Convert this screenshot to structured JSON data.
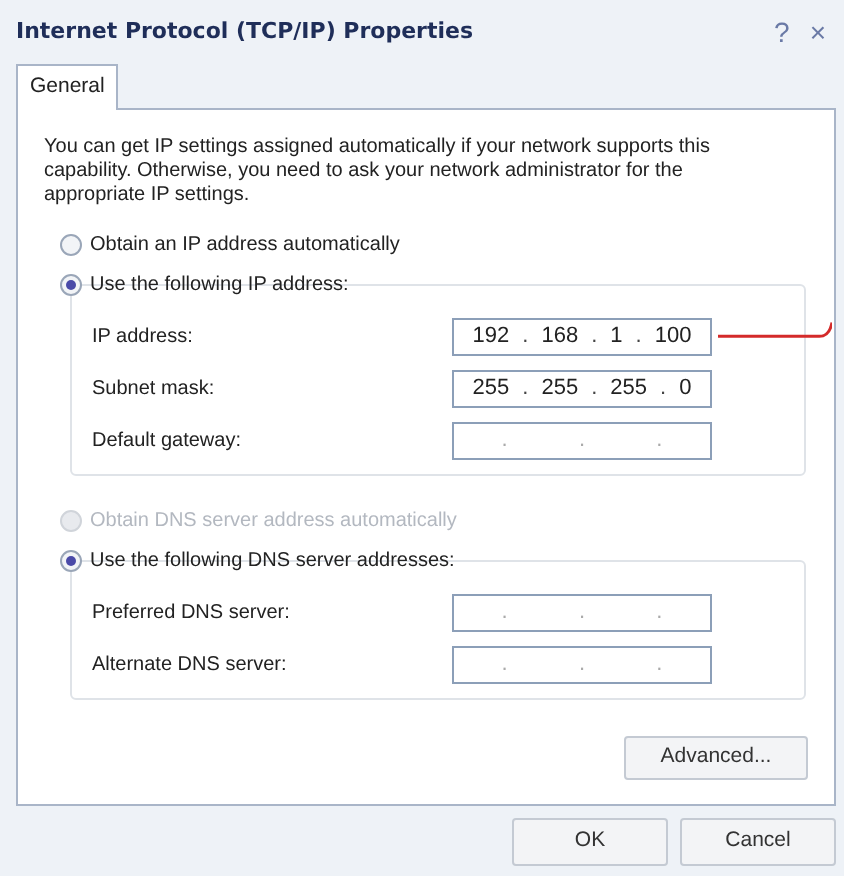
{
  "window": {
    "title": "Internet Protocol (TCP/IP) Properties",
    "help": "?",
    "close": "×"
  },
  "tabs": [
    {
      "label": "General",
      "selected": true
    }
  ],
  "intro": "You can get IP settings assigned automatically if your network supports this capability. Otherwise, you need to ask your network administrator for the appropriate IP settings.",
  "ip_group": {
    "options": [
      {
        "label": "Obtain an IP address automatically",
        "selected": false,
        "disabled": false
      },
      {
        "label": "Use the following IP address:",
        "selected": true,
        "disabled": false
      }
    ],
    "fields": [
      {
        "label": "IP address:",
        "parts": [
          "192",
          ".",
          "168",
          ".",
          "1",
          ".",
          "100"
        ],
        "annotated": true
      },
      {
        "label": "Subnet mask:",
        "parts": [
          "255",
          ".",
          "255",
          ".",
          "255",
          ".",
          "0"
        ],
        "annotated": false
      },
      {
        "label": "Default gateway:",
        "parts": [
          ".",
          ".",
          "."
        ],
        "annotated": false
      }
    ]
  },
  "dns_group": {
    "options": [
      {
        "label": "Obtain DNS server address automatically",
        "selected": false,
        "disabled": true
      },
      {
        "label": "Use the following DNS server addresses:",
        "selected": true,
        "disabled": false
      }
    ],
    "fields": [
      {
        "label": "Preferred DNS server:",
        "parts": [
          ".",
          ".",
          "."
        ],
        "annotated": false
      },
      {
        "label": "Alternate DNS server:",
        "parts": [
          ".",
          ".",
          "."
        ],
        "annotated": false
      }
    ]
  },
  "advanced_button": "Advanced...",
  "buttons": [
    "OK",
    "Cancel"
  ]
}
